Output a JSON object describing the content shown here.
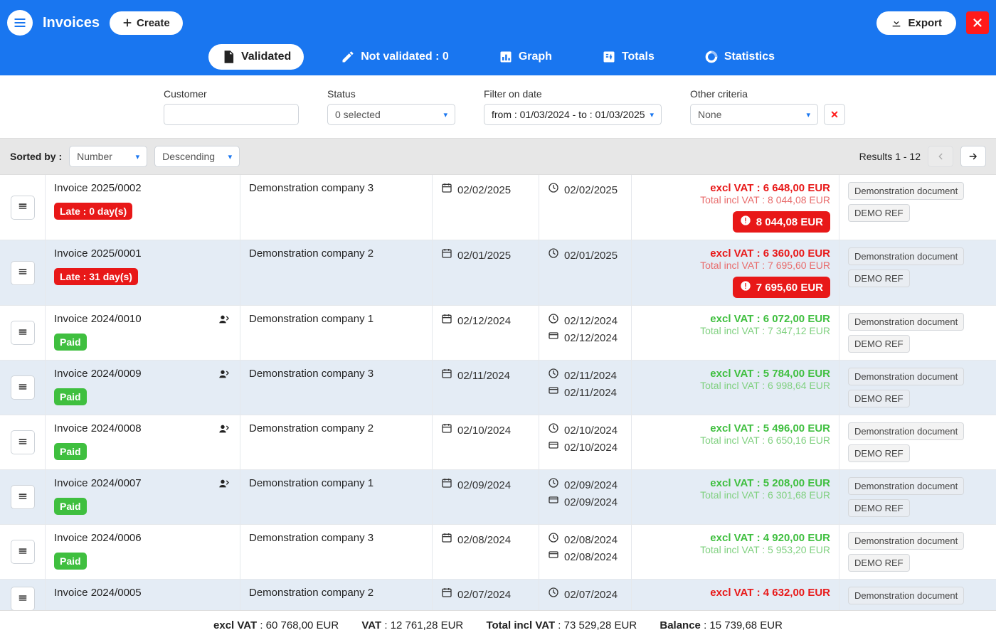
{
  "header": {
    "title": "Invoices",
    "create_label": "Create",
    "export_label": "Export"
  },
  "tabs": {
    "validated": "Validated",
    "not_validated": "Not validated : 0",
    "graph": "Graph",
    "totals": "Totals",
    "statistics": "Statistics"
  },
  "filters": {
    "customer_label": "Customer",
    "status_label": "Status",
    "status_value": "0 selected",
    "date_label": "Filter on date",
    "date_value": "from : 01/03/2024 - to : 01/03/2025",
    "other_label": "Other criteria",
    "other_value": "None"
  },
  "sort": {
    "label": "Sorted by :",
    "field": "Number",
    "dir": "Descending",
    "results": "Results 1 - 12"
  },
  "rows": [
    {
      "num": "Invoice 2025/0002",
      "customer": "Demonstration company 3",
      "date1": "02/02/2025",
      "date2a": "02/02/2025",
      "date2b": "",
      "ex": "excl VAT : 6 648,00 EUR",
      "inc": "Total incl VAT : 8 044,08 EUR",
      "due": "8 044,08 EUR",
      "status": "late",
      "status_label": "Late : 0 day(s)",
      "person": false,
      "tag1": "Demonstration document",
      "tag2": "DEMO REF"
    },
    {
      "num": "Invoice 2025/0001",
      "customer": "Demonstration company 2",
      "date1": "02/01/2025",
      "date2a": "02/01/2025",
      "date2b": "",
      "ex": "excl VAT : 6 360,00 EUR",
      "inc": "Total incl VAT : 7 695,60 EUR",
      "due": "7 695,60 EUR",
      "status": "late",
      "status_label": "Late : 31 day(s)",
      "person": false,
      "tag1": "Demonstration document",
      "tag2": "DEMO REF"
    },
    {
      "num": "Invoice 2024/0010",
      "customer": "Demonstration company 1",
      "date1": "02/12/2024",
      "date2a": "02/12/2024",
      "date2b": "02/12/2024",
      "ex": "excl VAT : 6 072,00 EUR",
      "inc": "Total incl VAT : 7 347,12 EUR",
      "due": "",
      "status": "paid",
      "status_label": "Paid",
      "person": true,
      "tag1": "Demonstration document",
      "tag2": "DEMO REF"
    },
    {
      "num": "Invoice 2024/0009",
      "customer": "Demonstration company 3",
      "date1": "02/11/2024",
      "date2a": "02/11/2024",
      "date2b": "02/11/2024",
      "ex": "excl VAT : 5 784,00 EUR",
      "inc": "Total incl VAT : 6 998,64 EUR",
      "due": "",
      "status": "paid",
      "status_label": "Paid",
      "person": true,
      "tag1": "Demonstration document",
      "tag2": "DEMO REF"
    },
    {
      "num": "Invoice 2024/0008",
      "customer": "Demonstration company 2",
      "date1": "02/10/2024",
      "date2a": "02/10/2024",
      "date2b": "02/10/2024",
      "ex": "excl VAT : 5 496,00 EUR",
      "inc": "Total incl VAT : 6 650,16 EUR",
      "due": "",
      "status": "paid",
      "status_label": "Paid",
      "person": true,
      "tag1": "Demonstration document",
      "tag2": "DEMO REF"
    },
    {
      "num": "Invoice 2024/0007",
      "customer": "Demonstration company 1",
      "date1": "02/09/2024",
      "date2a": "02/09/2024",
      "date2b": "02/09/2024",
      "ex": "excl VAT : 5 208,00 EUR",
      "inc": "Total incl VAT : 6 301,68 EUR",
      "due": "",
      "status": "paid",
      "status_label": "Paid",
      "person": true,
      "tag1": "Demonstration document",
      "tag2": "DEMO REF"
    },
    {
      "num": "Invoice 2024/0006",
      "customer": "Demonstration company 3",
      "date1": "02/08/2024",
      "date2a": "02/08/2024",
      "date2b": "02/08/2024",
      "ex": "excl VAT : 4 920,00 EUR",
      "inc": "Total incl VAT : 5 953,20 EUR",
      "due": "",
      "status": "paid",
      "status_label": "Paid",
      "person": false,
      "tag1": "Demonstration document",
      "tag2": "DEMO REF"
    },
    {
      "num": "Invoice 2024/0005",
      "customer": "Demonstration company 2",
      "date1": "02/07/2024",
      "date2a": "02/07/2024",
      "date2b": "",
      "ex": "excl VAT : 4 632,00 EUR",
      "inc": "",
      "due": "",
      "status": "",
      "status_label": "",
      "person": false,
      "tag1": "Demonstration document",
      "tag2": ""
    }
  ],
  "footer": {
    "ex_label": "excl VAT",
    "ex_val": " : 60 768,00 EUR",
    "vat_label": "VAT",
    "vat_val": " : 12 761,28 EUR",
    "inc_label": "Total incl VAT",
    "inc_val": " : 73 529,28 EUR",
    "bal_label": "Balance",
    "bal_val": " : 15 739,68 EUR"
  }
}
